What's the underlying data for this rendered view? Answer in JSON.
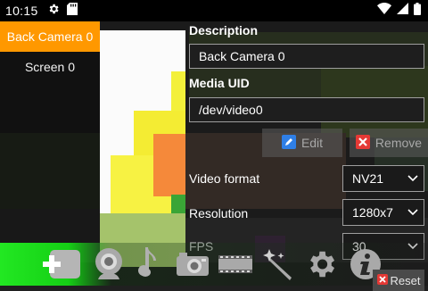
{
  "status_bar": {
    "time": "10:15",
    "icons": [
      "gear-icon",
      "sd-card-icon",
      "wifi-icon",
      "signal-icon",
      "battery-icon"
    ]
  },
  "sources": [
    {
      "label": "Back Camera 0",
      "selected": true
    },
    {
      "label": "Screen 0",
      "selected": false
    }
  ],
  "panel": {
    "description_label": "Description",
    "description_value": "Back Camera 0",
    "media_uid_label": "Media UID",
    "media_uid_value": "/dev/video0",
    "edit_label": "Edit",
    "remove_label": "Remove",
    "video_format_label": "Video format",
    "video_format_value": "NV21",
    "resolution_label": "Resolution",
    "resolution_value": "1280x7",
    "fps_label": "FPS",
    "fps_value": "30",
    "reset_label": "Reset"
  },
  "toolbar": {
    "icons": [
      "add-source-icon",
      "webcam-icon",
      "audio-note-icon",
      "camera-icon",
      "film-strip-icon",
      "magic-wand-icon",
      "settings-gear-icon",
      "info-icon"
    ]
  },
  "colors": {
    "accent_orange": "#ff9800",
    "toolbar_green": "#22e822",
    "remove_red": "#e53935",
    "edit_blue": "#2f7fe6"
  }
}
